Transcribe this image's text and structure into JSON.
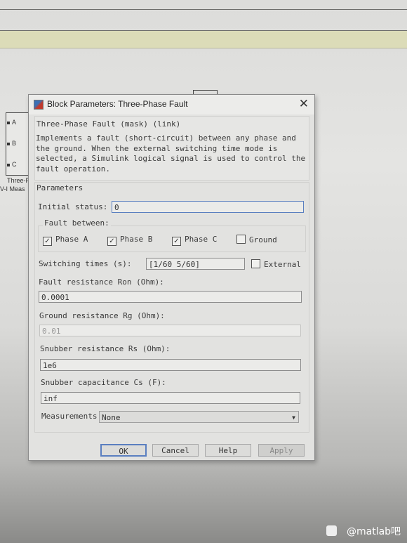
{
  "background": {
    "block_ports": [
      "A",
      "B",
      "C"
    ],
    "block_label_1": "Three-F",
    "block_label_2": "V-I Meas"
  },
  "dialog": {
    "title": "Block Parameters: Three-Phase Fault",
    "header": "Three-Phase Fault (mask) (link)",
    "description": "Implements a fault (short-circuit) between any phase and the ground. When the external switching time mode is selected, a Simulink logical signal is used to control the fault operation.",
    "parameters_label": "Parameters",
    "initial_status": {
      "label": "Initial status:",
      "value": "0"
    },
    "fault_between": {
      "label": "Fault between:",
      "options": [
        {
          "label": "Phase A",
          "checked": true
        },
        {
          "label": "Phase B",
          "checked": true
        },
        {
          "label": "Phase C",
          "checked": true
        },
        {
          "label": "Ground",
          "checked": false
        }
      ]
    },
    "switching_times": {
      "label": "Switching times (s):",
      "value": "[1/60 5/60]"
    },
    "external": {
      "label": "External",
      "checked": false
    },
    "fault_resistance": {
      "label": "Fault resistance Ron (Ohm):",
      "value": "0.0001"
    },
    "ground_resistance": {
      "label": "Ground resistance Rg (Ohm):",
      "value": "0.01",
      "disabled": true
    },
    "snubber_resistance": {
      "label": "Snubber resistance Rs (Ohm):",
      "value": "1e6"
    },
    "snubber_capacitance": {
      "label": "Snubber capacitance Cs (F):",
      "value": "inf"
    },
    "measurements": {
      "label": "Measurements",
      "value": "None"
    },
    "buttons": {
      "ok": "OK",
      "cancel": "Cancel",
      "help": "Help",
      "apply": "Apply"
    }
  },
  "watermark": "@matlab吧",
  "colors": {
    "focus_border": "#5a7fc0",
    "toolbar_band": "#dcdcb8"
  }
}
